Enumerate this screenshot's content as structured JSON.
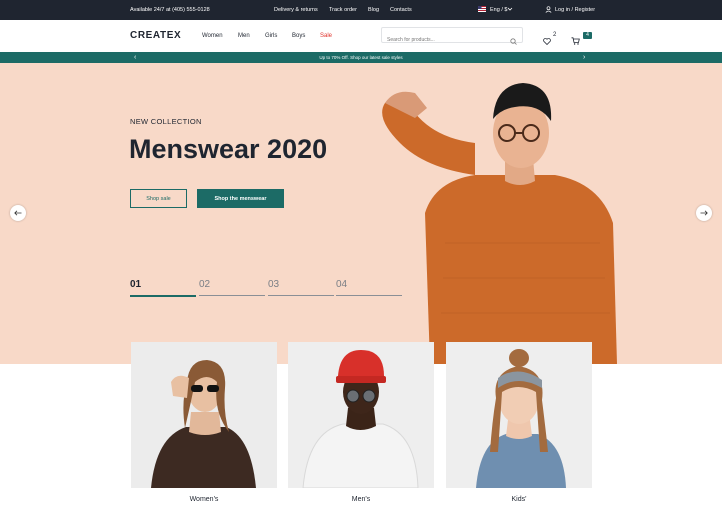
{
  "topbar": {
    "availability": "Available 24/7 at (405) 555-0128",
    "links": [
      "Delivery & returns",
      "Track order",
      "Blog",
      "Contacts"
    ],
    "locale": "Eng / $",
    "account": "Log in / Register"
  },
  "header": {
    "logo": "CREATEX",
    "nav": [
      "Women",
      "Men",
      "Girls",
      "Boys",
      "Sale"
    ],
    "search_placeholder": "Search for products...",
    "wishlist_count": "2",
    "cart_count": "4"
  },
  "promo": {
    "text": "Up to 70% Off. Shop our latest sale styles"
  },
  "hero": {
    "kicker": "NEW COLLECTION",
    "title": "Menswear 2020",
    "btn_sale": "Shop sale",
    "btn_menswear": "Shop the menswear",
    "slides": [
      "01",
      "02",
      "03",
      "04"
    ]
  },
  "categories": [
    "Women's",
    "Men's",
    "Kids'"
  ],
  "colors": {
    "topbar": "#1f2530",
    "accent": "#1c6b66",
    "sale": "#e0322b",
    "hero_bg": "#f8d9c8"
  }
}
